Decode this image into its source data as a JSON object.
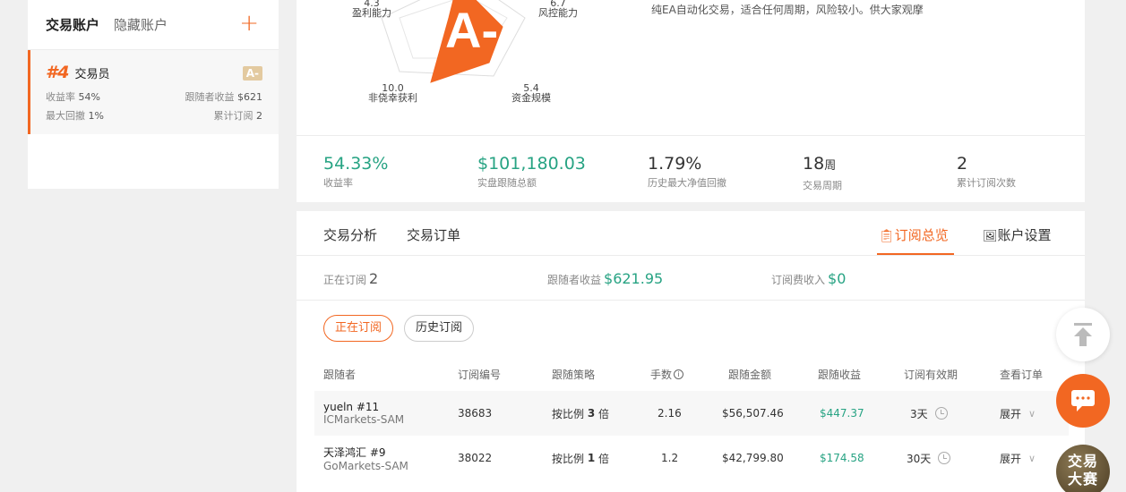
{
  "sidebar": {
    "tabs": [
      "交易账户",
      "隐藏账户"
    ],
    "add_label": "+",
    "account": {
      "rank": "#4",
      "name": "交易员",
      "grade": "A-",
      "return_label": "收益率",
      "return_value": "54%",
      "follower_profit_label": "跟随者收益",
      "follower_profit_value": "$621",
      "max_drawdown_label": "最大回撤",
      "max_drawdown_value": "1%",
      "subs_label": "累计订阅",
      "subs_value": "2"
    }
  },
  "radar": {
    "grade": "A-",
    "axes": [
      {
        "value": "4.3",
        "label": "盈利能力"
      },
      {
        "value": "6.7",
        "label": "风控能力"
      },
      {
        "value": "5.4",
        "label": "资金规模"
      },
      {
        "value": "10.0",
        "label": "非侥幸获利"
      }
    ],
    "accent": "#f26722"
  },
  "description": "纯EA自动化交易，适合任何周期，风险较小。供大家观摩",
  "stats": [
    {
      "value": "54.33%",
      "unit": "",
      "label": "收益率",
      "green": true
    },
    {
      "value": "$101,180.03",
      "unit": "",
      "label": "实盘跟随总额",
      "green": true
    },
    {
      "value": "1.79%",
      "unit": "",
      "label": "历史最大净值回撤",
      "green": false
    },
    {
      "value": "18",
      "unit": "周",
      "label": "交易周期",
      "green": false
    },
    {
      "value": "2",
      "unit": "",
      "label": "累计订阅次数",
      "green": false
    }
  ],
  "tabs": {
    "analysis": "交易分析",
    "orders": "交易订单",
    "subscription_overview": "订阅总览",
    "account_settings": "账户设置"
  },
  "summary": {
    "active_label": "正在订阅",
    "active_value": "2",
    "follower_profit_label": "跟随者收益",
    "follower_profit_value": "$621.95",
    "fee_label": "订阅费收入",
    "fee_value": "$0"
  },
  "filters": {
    "active": "正在订阅",
    "history": "历史订阅"
  },
  "table": {
    "headers": [
      "跟随者",
      "订阅编号",
      "跟随策略",
      "手数",
      "跟随金额",
      "跟随收益",
      "订阅有效期",
      "查看订单"
    ],
    "rows": [
      {
        "follower": "yueln #11",
        "broker": "ICMarkets-SAM",
        "sub_id": "38683",
        "strategy_prefix": "按比例",
        "strategy_mult": "3",
        "strategy_suffix": "倍",
        "lots": "2.16",
        "amount": "$56,507.46",
        "profit": "$447.37",
        "validity": "3天",
        "action": "展开"
      },
      {
        "follower": "天泽鸿汇 #9",
        "broker": "GoMarkets-SAM",
        "sub_id": "38022",
        "strategy_prefix": "按比例",
        "strategy_mult": "1",
        "strategy_suffix": "倍",
        "lots": "1.2",
        "amount": "$42,799.80",
        "profit": "$174.58",
        "validity": "30天",
        "action": "展开"
      }
    ]
  },
  "floating": {
    "contest_line1": "交易",
    "contest_line2": "大赛"
  }
}
